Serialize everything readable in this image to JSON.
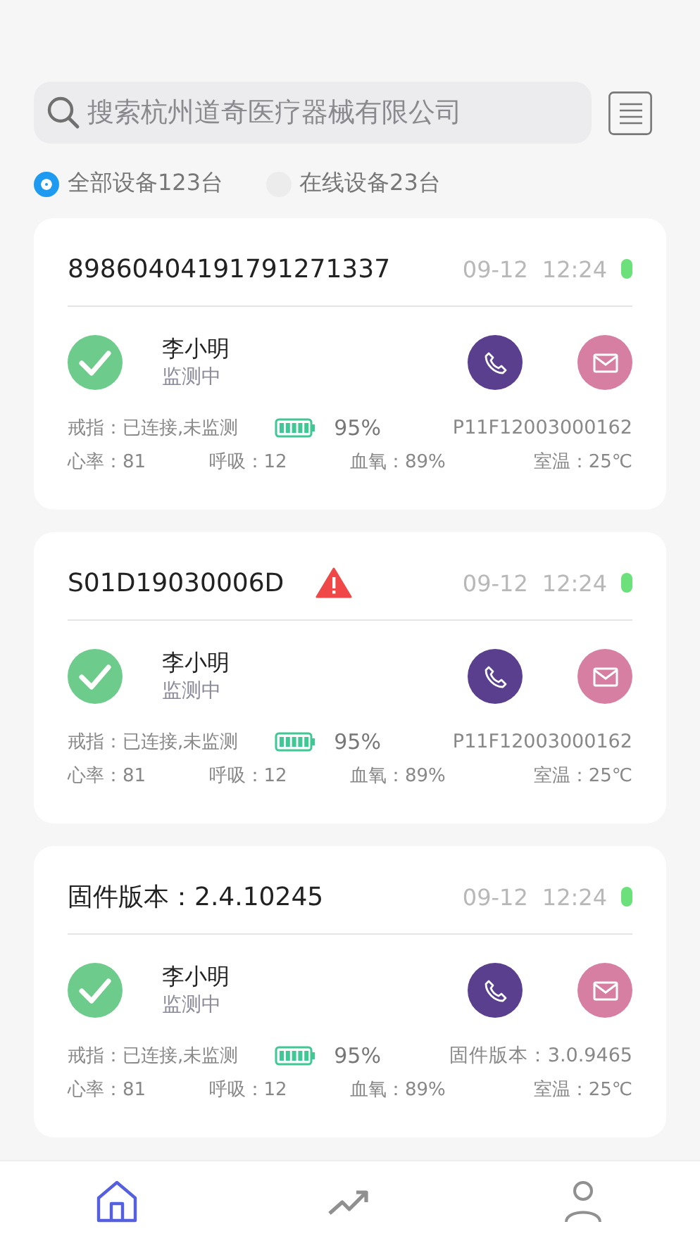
{
  "search": {
    "placeholder": "搜索杭州道奇医疗器械有限公司"
  },
  "filters": [
    {
      "label": "全部设备123台",
      "selected": true
    },
    {
      "label": "在线设备23台",
      "selected": false
    }
  ],
  "devices": [
    {
      "title": "89860404191791271337",
      "alert": false,
      "date": "09-12",
      "time": "12:24",
      "online": true,
      "name": "李小明",
      "status": "监测中",
      "ring": "戒指：已连接,未监测",
      "battery": "95%",
      "info": "P11F12003000162",
      "stats": [
        "心率：81",
        "呼吸：12",
        "血氧：89%",
        "室温：25℃"
      ]
    },
    {
      "title": "S01D19030006D",
      "alert": true,
      "date": "09-12",
      "time": "12:24",
      "online": true,
      "name": "李小明",
      "status": "监测中",
      "ring": "戒指：已连接,未监测",
      "battery": "95%",
      "info": "P11F12003000162",
      "stats": [
        "心率：81",
        "呼吸：12",
        "血氧：89%",
        "室温：25℃"
      ]
    },
    {
      "title": "固件版本：2.4.10245",
      "alert": false,
      "date": "09-12",
      "time": "12:24",
      "online": true,
      "name": "李小明",
      "status": "监测中",
      "ring": "戒指：已连接,未监测",
      "battery": "95%",
      "info": "固件版本：3.0.9465",
      "stats": [
        "心率：81",
        "呼吸：12",
        "血氧：89%",
        "室温：25℃"
      ]
    }
  ],
  "nav": [
    {
      "kind": "home",
      "selected": true
    },
    {
      "kind": "trend",
      "selected": false
    },
    {
      "kind": "user",
      "selected": false
    }
  ]
}
